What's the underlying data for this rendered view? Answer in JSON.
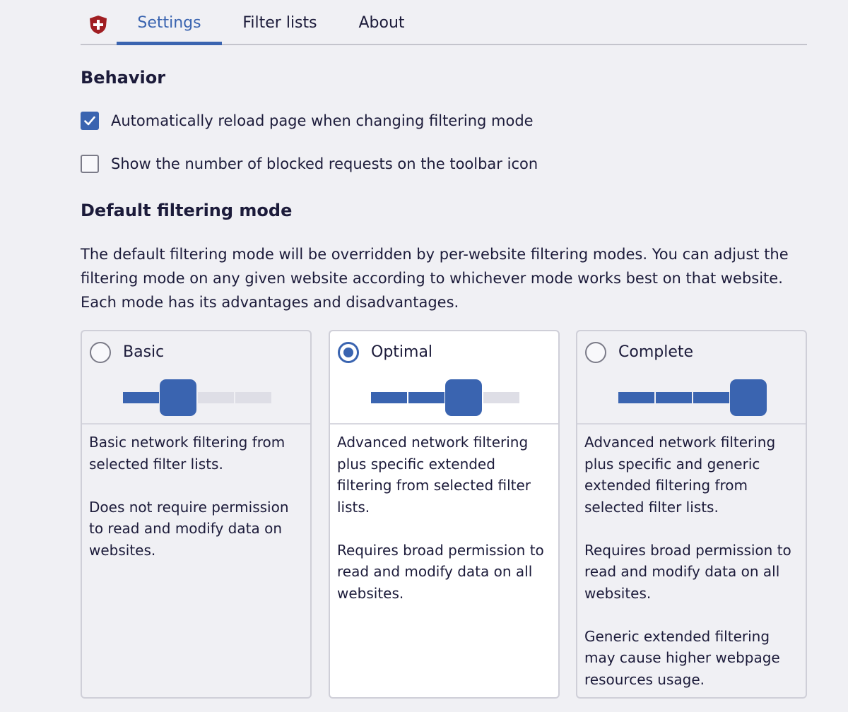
{
  "tabs": {
    "settings": "Settings",
    "filter_lists": "Filter lists",
    "about": "About",
    "active": "settings"
  },
  "behavior": {
    "heading": "Behavior",
    "auto_reload": {
      "label": "Automatically reload page when changing filtering mode",
      "checked": true
    },
    "show_count": {
      "label": "Show the number of blocked requests on the toolbar icon",
      "checked": false
    }
  },
  "default_mode": {
    "heading": "Default filtering mode",
    "description": "The default filtering mode will be overridden by per-website filtering modes. You can adjust the filtering mode on any given website according to whichever mode works best on that website. Each mode has its advantages and disadvantages.",
    "selected": "optimal",
    "modes": {
      "basic": {
        "label": "Basic",
        "level": 1,
        "paragraphs": [
          "Basic network filtering from selected filter lists.",
          "Does not require permission to read and modify data on websites."
        ]
      },
      "optimal": {
        "label": "Optimal",
        "level": 2,
        "paragraphs": [
          "Advanced network filtering plus specific extended filtering from selected filter lists.",
          "Requires broad permission to read and modify data on all websites."
        ]
      },
      "complete": {
        "label": "Complete",
        "level": 3,
        "paragraphs": [
          "Advanced network filtering plus specific and generic extended filtering from selected filter lists.",
          "Requires broad permission to read and modify data on all websites.",
          "Generic extended filtering may cause higher webpage resources usage."
        ]
      }
    }
  },
  "colors": {
    "accent": "#3a64b0",
    "logo": "#a01e22",
    "text": "#1c1b3a",
    "background": "#f0f0f4"
  }
}
